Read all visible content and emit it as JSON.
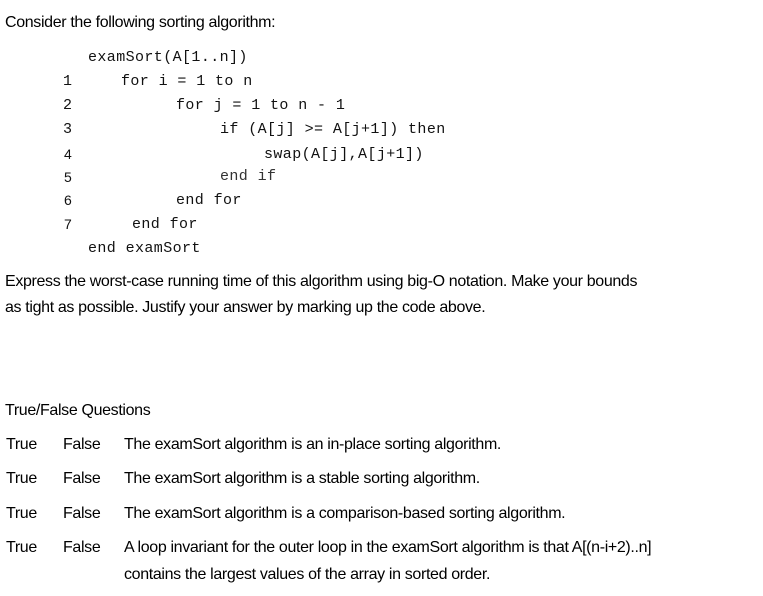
{
  "intro": "Consider the following sorting algorithm:",
  "code": {
    "header": "examSort(A[1..n])",
    "lines": [
      {
        "num": "1",
        "text": "for i = 1 to n"
      },
      {
        "num": "2",
        "text": "for j = 1 to n - 1"
      },
      {
        "num": "3",
        "text": "if (A[j] >= A[j+1]) then"
      },
      {
        "num": "4",
        "text": "swap(A[j],A[j+1])"
      },
      {
        "num": "5",
        "text": "end if"
      },
      {
        "num": "6",
        "text": "end for"
      },
      {
        "num": "7",
        "text": "end for"
      }
    ],
    "footer": "end examSort"
  },
  "question": {
    "line1": "Express the worst-case running time of this algorithm using big-O notation.  Make your bounds",
    "line2": "as tight as possible.  Justify your answer by marking up the code above."
  },
  "true_false": {
    "heading": "True/False Questions",
    "true_label": "True",
    "false_label": "False",
    "items": [
      {
        "text": "The examSort algorithm is an in-place sorting algorithm."
      },
      {
        "text": "The examSort algorithm is a stable sorting algorithm."
      },
      {
        "text": "The examSort algorithm is a comparison-based sorting algorithm."
      },
      {
        "text": "A loop invariant for the outer loop in the examSort algorithm is that A[(n-i+2)..n]",
        "text2": "contains the largest values of the array in sorted order."
      }
    ]
  }
}
